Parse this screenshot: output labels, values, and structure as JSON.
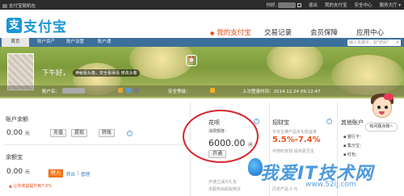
{
  "topbar": {
    "left_text": "支付宝随机包",
    "greeting": "你好,",
    "exit": "退出",
    "my_alipay": "我的支付宝",
    "security_center": "安全中心",
    "service_center": "服务大厅"
  },
  "header": {
    "logo_text": "支付宝",
    "nav": [
      "我的支付宝",
      "交易记录",
      "会员保障",
      "应用中心"
    ]
  },
  "tabs": {
    "items": [
      "首页",
      "账户资产",
      "账户设置",
      "账户通"
    ],
    "search_placeholder": "输入关键字，如\"密码\""
  },
  "banner": {
    "greeting": "下午好，",
    "avatar_tip": "神秘看头像，安全看得清 修改头像",
    "account_label": "账户名：",
    "security_label": "安全等级：",
    "last_login": "上次登录时间：2014.12.24 09:12:47"
  },
  "balance": {
    "title": "账户余额",
    "amount": "0.00",
    "unit": "元",
    "buttons": [
      "充值",
      "提现",
      "转账"
    ]
  },
  "yuebao": {
    "title": "余额宝",
    "amount": "0.00",
    "unit": "元",
    "transfer_in": "转入",
    "transfer_out": "转出",
    "manage": "管理",
    "promo": "让你收益提升到7.0%"
  },
  "huabei": {
    "title": "花呗",
    "limit_label": "消费额度：",
    "limit": "6000.00",
    "unit": "元",
    "open_button": "开通",
    "note1": "开通立减大礼包",
    "note2": "本服务由蚂蚁微贷"
  },
  "zhaocai": {
    "title": "招财宝",
    "subtitle": "今日主推产品年化收益率",
    "rate": "5.5%-7.4%",
    "note": "可随时变现 投资更灵活",
    "note2": "历史产品 0 元"
  },
  "other": {
    "title": "其他账户",
    "bank": "银行卡：",
    "points": "集分宝：",
    "red_packet": "红包："
  },
  "chat": {
    "bubble": "有问题点我~"
  },
  "watermark": {
    "text": "我爱IT技术网",
    "url": "www.52ij.com"
  }
}
